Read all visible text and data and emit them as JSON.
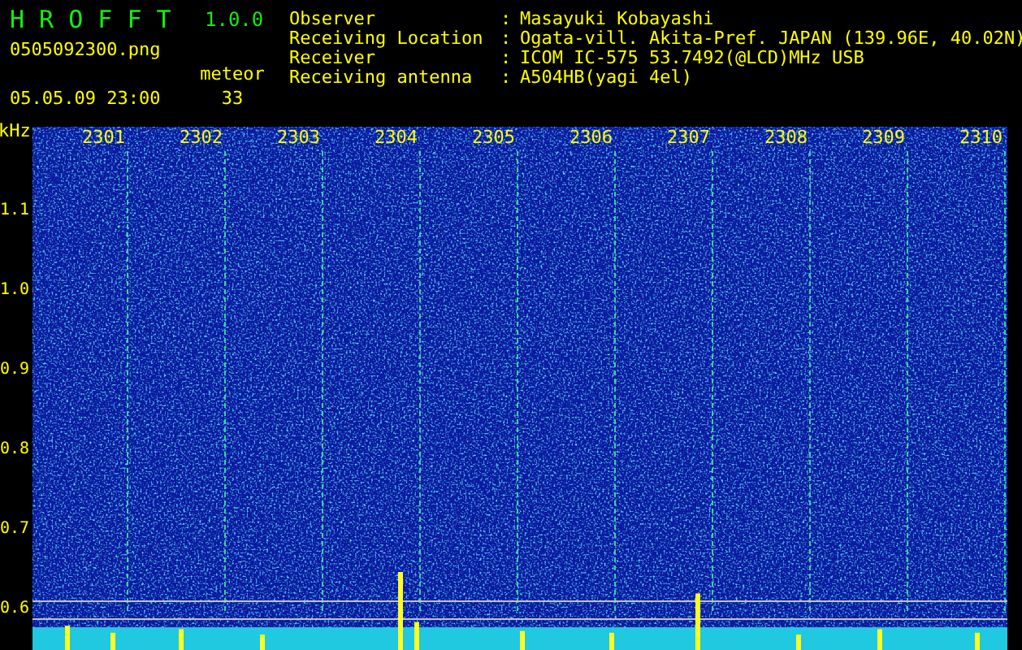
{
  "app": {
    "title": "H R O F F T",
    "version": "1.0.0",
    "file": "0505092300.png",
    "datetime": "05.05.09 23:00",
    "meteor_label": "meteor",
    "meteor_count": "33"
  },
  "info": [
    {
      "label": "Observer",
      "colon": ":",
      "value": "Masayuki Kobayashi"
    },
    {
      "label": "Receiving Location",
      "colon": ":",
      "value": "Ogata-vill. Akita-Pref. JAPAN (139.96E, 40.02N)"
    },
    {
      "label": "Receiver",
      "colon": ":",
      "value": "ICOM IC-575 53.7492(@LCD)MHz USB"
    },
    {
      "label": "Receiving antenna",
      "colon": ":",
      "value": "A504HB(yagi 4el)"
    }
  ],
  "frequency_axis": {
    "unit": "kHz",
    "ticks": [
      "1.1",
      "1.0",
      "0.9",
      "0.8",
      "0.7",
      "0.6"
    ]
  },
  "time_axis": {
    "ticks": [
      "2301",
      "2302",
      "2303",
      "2304",
      "2305",
      "2306",
      "2307",
      "2308",
      "2309",
      "2310"
    ]
  }
}
